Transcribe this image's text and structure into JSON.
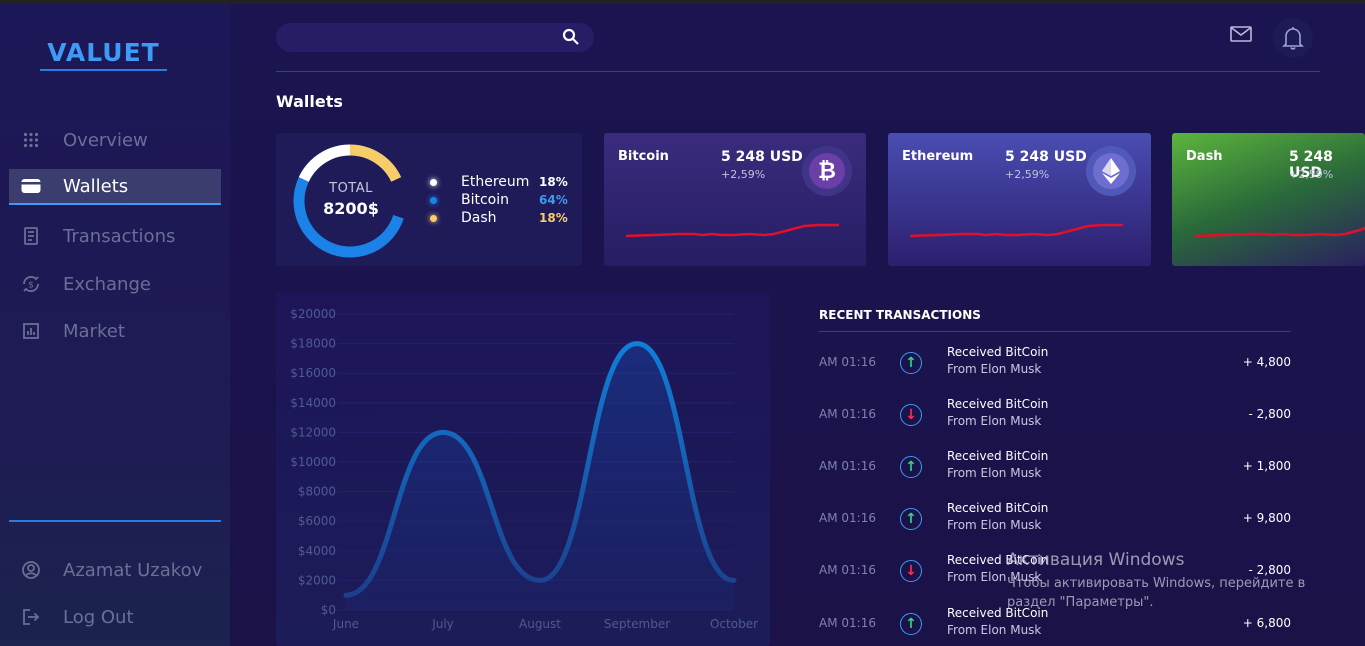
{
  "app": {
    "logo": "VALUET"
  },
  "sidebar": {
    "items": [
      {
        "label": "Overview",
        "icon": "grid-icon"
      },
      {
        "label": "Wallets",
        "icon": "wallet-icon",
        "active": true
      },
      {
        "label": "Transactions",
        "icon": "receipt-icon"
      },
      {
        "label": "Exchange",
        "icon": "exchange-icon"
      },
      {
        "label": "Market",
        "icon": "bar-chart-icon"
      }
    ],
    "user": {
      "label": "Azamat Uzakov",
      "icon": "user-icon"
    },
    "logout": {
      "label": "Log Out",
      "icon": "logout-icon"
    }
  },
  "header": {
    "search": {
      "placeholder": "",
      "value": ""
    },
    "icons": [
      "mail-icon",
      "bell-icon"
    ]
  },
  "wallets": {
    "title": "Wallets",
    "total": {
      "label": "TOTAL",
      "value": "8200$",
      "legend": [
        {
          "name": "Ethereum",
          "pct": "18%",
          "color": "#ffffff"
        },
        {
          "name": "Bitcoin",
          "pct": "64%",
          "color": "#3d9bf5"
        },
        {
          "name": "Dash",
          "pct": "18%",
          "color": "#f7cd6a"
        }
      ]
    },
    "cards": [
      {
        "name": "Bitcoin",
        "amount": "5 248 USD",
        "change": "+2,59%",
        "coin": "bitcoin-icon"
      },
      {
        "name": "Ethereum",
        "amount": "5 248 USD",
        "change": "+2,59%",
        "coin": "ethereum-icon"
      },
      {
        "name": "Dash",
        "amount": "5 248 USD",
        "change": "+2,59%",
        "coin": "dash-icon"
      }
    ]
  },
  "chart_data": {
    "type": "area",
    "categories": [
      "June",
      "July",
      "August",
      "September",
      "October"
    ],
    "values": [
      1000,
      12000,
      2000,
      18000,
      2000
    ],
    "title": "",
    "xlabel": "",
    "ylabel": "",
    "ylim": [
      0,
      20000
    ],
    "yticks": [
      "$0",
      "$2000",
      "$4000",
      "$6000",
      "$8000",
      "$10000",
      "$12000",
      "$14000",
      "$16000",
      "$18000",
      "$20000"
    ],
    "color": "#0f7fd8"
  },
  "transactions": {
    "title": "RECENT TRANSACTIONS",
    "rows": [
      {
        "time": "AM 01:16",
        "dir": "up",
        "title": "Received BitCoin",
        "from": "From Elon Musk",
        "amount": "+ 4,800"
      },
      {
        "time": "AM 01:16",
        "dir": "down",
        "title": "Received BitCoin",
        "from": "From Elon Musk",
        "amount": "- 2,800"
      },
      {
        "time": "AM 01:16",
        "dir": "up",
        "title": "Received BitCoin",
        "from": "From Elon Musk",
        "amount": "+ 1,800"
      },
      {
        "time": "AM 01:16",
        "dir": "up",
        "title": "Received BitCoin",
        "from": "From Elon Musk",
        "amount": "+ 9,800"
      },
      {
        "time": "AM 01:16",
        "dir": "down",
        "title": "Received BitCoin",
        "from": "From Elon Musk",
        "amount": "- 2,800"
      },
      {
        "time": "AM 01:16",
        "dir": "up",
        "title": "Received BitCoin",
        "from": "From Elon Musk",
        "amount": "+ 6,800"
      }
    ]
  },
  "watermark": {
    "line1": "Активация Windows",
    "line2": "Чтобы активировать Windows, перейдите в",
    "line3": "раздел \"Параметры\"."
  }
}
